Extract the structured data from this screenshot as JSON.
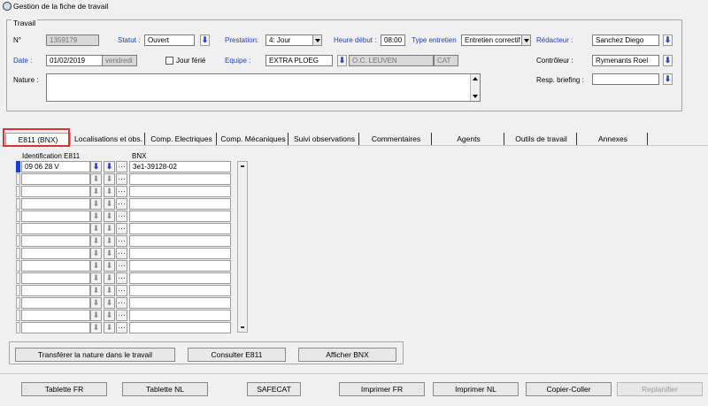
{
  "window": {
    "title": "Gestion de la fiche de travail"
  },
  "travail": {
    "group_title": "Travail",
    "numero_label": "N°",
    "numero_value": "1359179",
    "statut_label": "Statut :",
    "statut_value": "Ouvert",
    "prestation_label": "Prestation:",
    "prestation_value": "4: Jour",
    "heure_debut_label": "Heure début :",
    "heure_debut_value": "08:00",
    "type_entretien_label": "Type entretien",
    "type_entretien_value": "Entretien correctif",
    "redacteur_label": "Rédacteur :",
    "redacteur_value": "Sanchez Diego",
    "date_label": "Date :",
    "date_value": "01/02/2019",
    "jour_value": "vendredi",
    "jour_ferie_label": "Jour férié",
    "equipe_label": "Equipe :",
    "equipe_value": "EXTRA PLOEG",
    "equipe_oc_value": "O.C. LEUVEN",
    "equipe_code_value": "CAT",
    "controleur_label": "Contrôleur :",
    "controleur_value": "Rymenants Roel",
    "nature_label": "Nature :",
    "nature_value": "",
    "resp_briefing_label": "Resp. briefing :",
    "resp_briefing_value": ""
  },
  "tabs": [
    {
      "label": "E811 (BNX)"
    },
    {
      "label": "Localisations et obs."
    },
    {
      "label": "Comp. Electriques"
    },
    {
      "label": "Comp. Mécaniques"
    },
    {
      "label": "Suivi observations"
    },
    {
      "label": "Commentaires"
    },
    {
      "label": "Agents"
    },
    {
      "label": "Outils de travail"
    },
    {
      "label": "Annexes"
    }
  ],
  "grid": {
    "col_identification": "Identification E811",
    "col_bnx": "BNX",
    "rows": [
      {
        "identification": "09 06 28 V",
        "bnx": "3e1-39128-02"
      },
      {
        "identification": "",
        "bnx": ""
      },
      {
        "identification": "",
        "bnx": ""
      },
      {
        "identification": "",
        "bnx": ""
      },
      {
        "identification": "",
        "bnx": ""
      },
      {
        "identification": "",
        "bnx": ""
      },
      {
        "identification": "",
        "bnx": ""
      },
      {
        "identification": "",
        "bnx": ""
      },
      {
        "identification": "",
        "bnx": ""
      },
      {
        "identification": "",
        "bnx": ""
      },
      {
        "identification": "",
        "bnx": ""
      },
      {
        "identification": "",
        "bnx": ""
      },
      {
        "identification": "",
        "bnx": ""
      },
      {
        "identification": "",
        "bnx": ""
      }
    ],
    "lookup_icon": "download-arrow-icon",
    "ellipsis_label": "···"
  },
  "tab_buttons": {
    "transferer": "Transférer la nature dans le travail",
    "consulter": "Consulter E811",
    "afficher": "Afficher BNX"
  },
  "footer": {
    "tablette_fr": "Tablette FR",
    "tablette_nl": "Tablette NL",
    "safecat": "SAFECAT",
    "imprimer_fr": "Imprimer FR",
    "imprimer_nl": "Imprimer NL",
    "copier_coller": "Copier-Coller",
    "replanifier": "Replanifier"
  },
  "colors": {
    "label_blue": "#1e3fc8",
    "highlight_red": "#e03030"
  }
}
